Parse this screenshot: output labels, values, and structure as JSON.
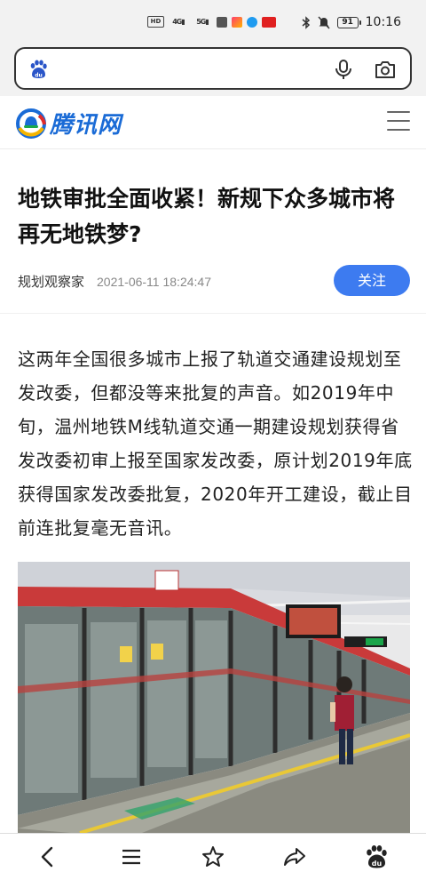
{
  "status_bar": {
    "hd_label": "HD",
    "signal1": "4G",
    "signal2": "5G",
    "battery": "91",
    "time": "10:16"
  },
  "search": {
    "placeholder": "",
    "icons": [
      "baidu-paw-icon",
      "microphone-icon",
      "camera-icon"
    ]
  },
  "site": {
    "name": "腾讯网"
  },
  "article": {
    "title": "地铁审批全面收紧！新规下众多城市将再无地铁梦?",
    "author": "规划观察家",
    "date": "2021-06-11 18:24:47",
    "follow_label": "关注",
    "body": "这两年全国很多城市上报了轨道交通建设规划至发改委，但都没等来批复的声音。如2019年中旬，温州地铁M线轨道交通一期建设规划获得省发改委初审上报至国家发改委，原计划2019年底获得国家发改委批复，2020年开工建设，截止目前连批复毫无音讯。"
  },
  "bottom_nav": {
    "items": [
      "back-icon",
      "menu-icon",
      "star-icon",
      "share-icon",
      "baidu-home-icon"
    ]
  },
  "colors": {
    "accent": "#3d7bf0",
    "logo_blue": "#1a6bd6",
    "background": "#ffffff",
    "bar_bg": "#f2f2f2"
  }
}
